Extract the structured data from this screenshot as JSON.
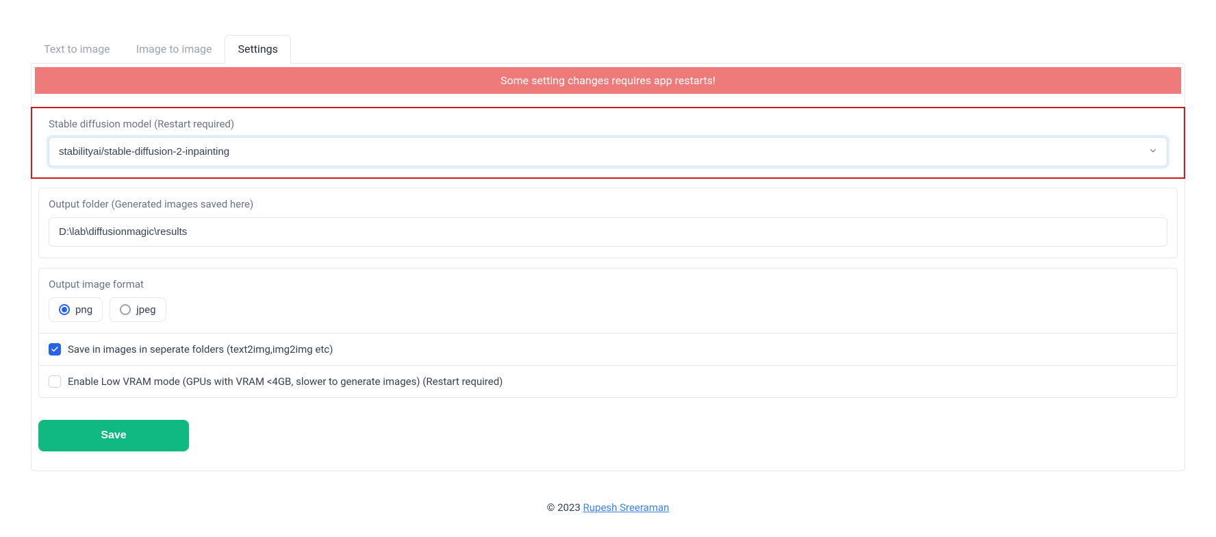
{
  "tabs": {
    "text_to_image": "Text to image",
    "image_to_image": "Image to image",
    "settings": "Settings"
  },
  "alert": "Some setting changes requires app restarts!",
  "model": {
    "label": "Stable diffusion model (Restart required)",
    "value": "stabilityai/stable-diffusion-2-inpainting"
  },
  "output_folder": {
    "label": "Output folder (Generated images saved here)",
    "value": "D:\\lab\\diffusionmagic\\results"
  },
  "output_format": {
    "label": "Output image format",
    "options": {
      "png": "png",
      "jpeg": "jpeg"
    },
    "selected": "png"
  },
  "save_separate": {
    "label": "Save in images in seperate folders (text2img,img2img etc)",
    "checked": true
  },
  "low_vram": {
    "label": "Enable Low VRAM mode (GPUs with VRAM <4GB, slower to generate images) (Restart required)",
    "checked": false
  },
  "save_button": "Save",
  "footer": {
    "prefix": "© 2023 ",
    "link_text": "Rupesh Sreeraman"
  }
}
